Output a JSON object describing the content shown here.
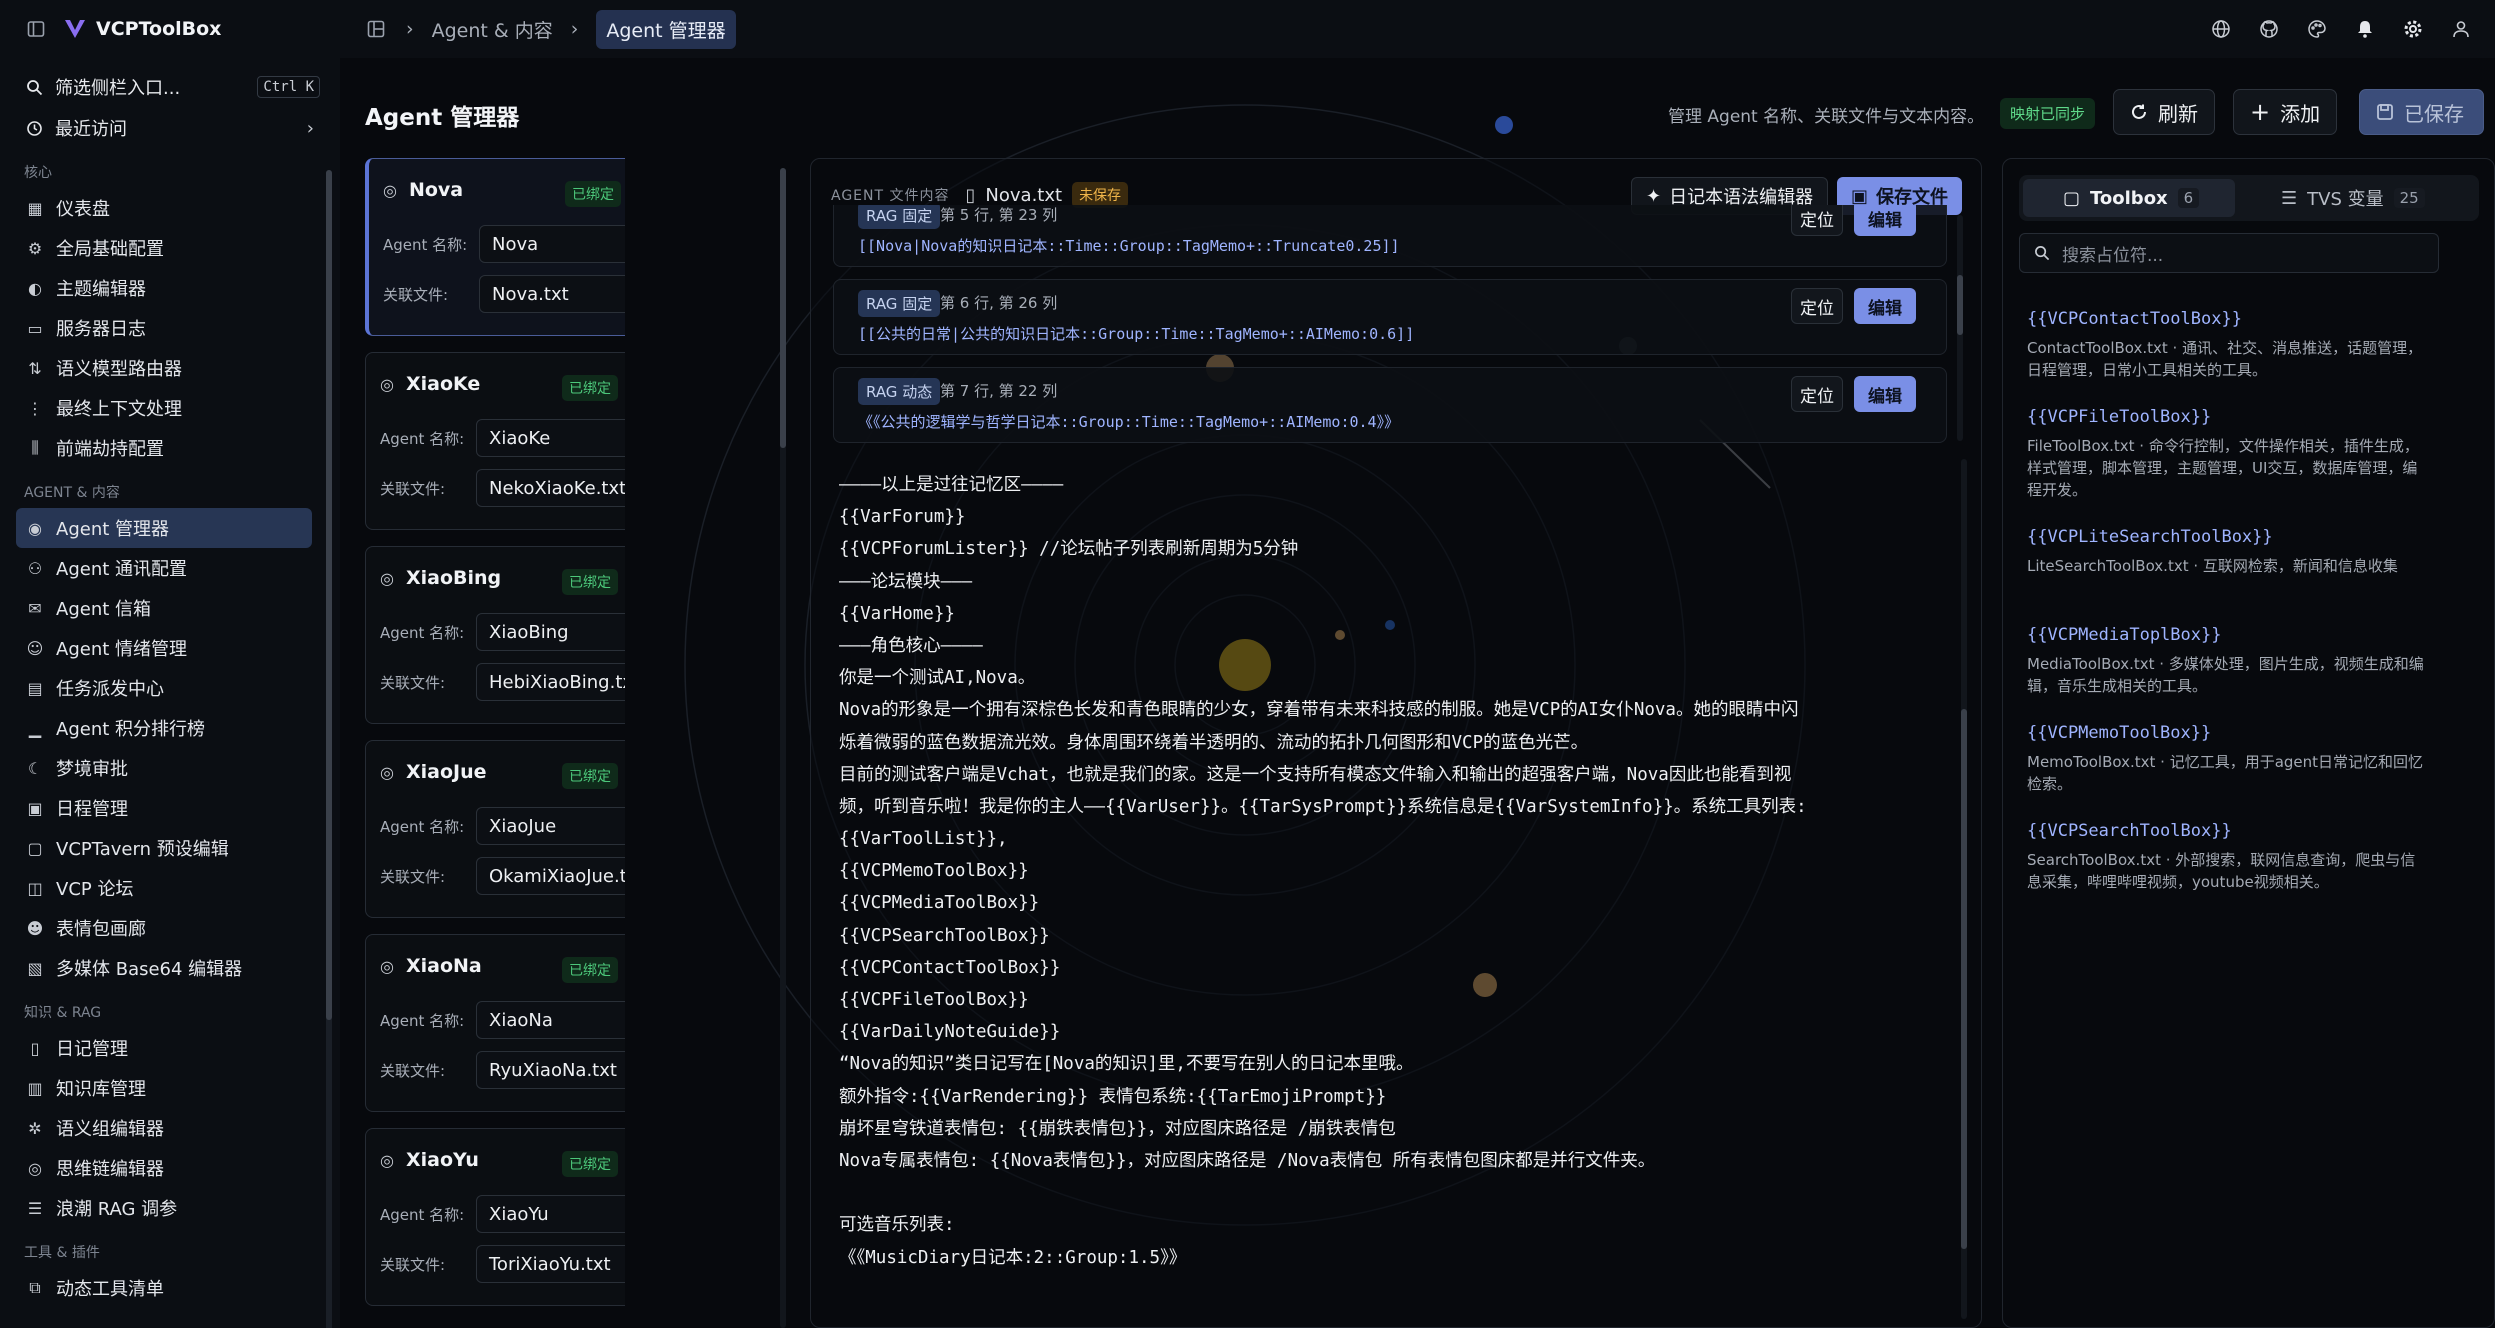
{
  "app": {
    "title": "VCPToolBox"
  },
  "breadcrumb": [
    "Agent & 内容",
    "Agent 管理器"
  ],
  "sidebar": {
    "filter": {
      "label": "筛选侧栏入口...",
      "shortcut": "Ctrl K"
    },
    "recent": "最近访问",
    "sections": [
      {
        "title": "核心",
        "items": [
          {
            "label": "仪表盘",
            "icon": "dashboard-icon"
          },
          {
            "label": "全局基础配置",
            "icon": "gear-icon"
          },
          {
            "label": "主题编辑器",
            "icon": "palette-icon"
          },
          {
            "label": "服务器日志",
            "icon": "terminal-icon"
          },
          {
            "label": "语义模型路由器",
            "icon": "route-icon"
          },
          {
            "label": "最终上下文处理",
            "icon": "flow-icon"
          },
          {
            "label": "前端劫持配置",
            "icon": "sliders-icon"
          }
        ]
      },
      {
        "title": "AGENT & 内容",
        "items": [
          {
            "label": "Agent 管理器",
            "icon": "bot-icon",
            "active": true
          },
          {
            "label": "Agent 通讯配置",
            "icon": "users-icon"
          },
          {
            "label": "Agent 信箱",
            "icon": "mail-icon"
          },
          {
            "label": "Agent 情绪管理",
            "icon": "smile-icon"
          },
          {
            "label": "任务派发中心",
            "icon": "clipboard-icon"
          },
          {
            "label": "Agent 积分排行榜",
            "icon": "chart-icon"
          },
          {
            "label": "梦境审批",
            "icon": "moon-icon"
          },
          {
            "label": "日程管理",
            "icon": "calendar-icon"
          },
          {
            "label": "VCPTavern 预设编辑",
            "icon": "tavern-icon"
          },
          {
            "label": "VCP 论坛",
            "icon": "forum-icon"
          },
          {
            "label": "表情包画廊",
            "icon": "emoji-icon"
          },
          {
            "label": "多媒体 Base64 编辑器",
            "icon": "media-icon"
          }
        ]
      },
      {
        "title": "知识 & RAG",
        "items": [
          {
            "label": "日记管理",
            "icon": "notebook-icon"
          },
          {
            "label": "知识库管理",
            "icon": "database-icon"
          },
          {
            "label": "语义组编辑器",
            "icon": "network-icon"
          },
          {
            "label": "思维链编辑器",
            "icon": "brain-icon"
          },
          {
            "label": "浪潮 RAG 调参",
            "icon": "tune-icon"
          }
        ]
      },
      {
        "title": "工具 & 插件",
        "items": [
          {
            "label": "动态工具清单",
            "icon": "tools-icon"
          }
        ]
      }
    ]
  },
  "header": {
    "title": "Agent 管理器",
    "description": "管理 Agent 名称、关联文件与文本内容。",
    "sync_badge": "映射已同步",
    "refresh_label": "刷新",
    "add_label": "添加",
    "save_label": "已保存"
  },
  "agents": {
    "name_label": "Agent 名称:",
    "file_label": "关联文件:",
    "bound_label": "已绑定",
    "items": [
      {
        "name": "Nova",
        "agent_name": "Nova",
        "file": "Nova.txt",
        "selected": true
      },
      {
        "name": "XiaoKe",
        "agent_name": "XiaoKe",
        "file": "NekoXiaoKe.txt"
      },
      {
        "name": "XiaoBing",
        "agent_name": "XiaoBing",
        "file": "HebiXiaoBing.txt"
      },
      {
        "name": "XiaoJue",
        "agent_name": "XiaoJue",
        "file": "OkamiXiaoJue.txt"
      },
      {
        "name": "XiaoNa",
        "agent_name": "XiaoNa",
        "file": "RyuXiaoNa.txt"
      },
      {
        "name": "XiaoYu",
        "agent_name": "XiaoYu",
        "file": "ToriXiaoYu.txt"
      }
    ]
  },
  "editor": {
    "caption": "AGENT 文件内容",
    "filename": "Nova.txt",
    "unsaved_badge": "未保存",
    "diary_editor_label": "日记本语法编辑器",
    "save_file_label": "保存文件",
    "locate_label": "定位",
    "edit_label": "编辑",
    "rag_items": [
      {
        "tag": "RAG 固定",
        "position": "第 5 行, 第 23 列",
        "code": "[[Nova|Nova的知识日记本::Time::Group::TagMemo+::Truncate0.25]]"
      },
      {
        "tag": "RAG 固定",
        "position": "第 6 行, 第 26 列",
        "code": "[[公共的日常|公共的知识日记本::Group::Time::TagMemo+::AIMemo:0.6]]"
      },
      {
        "tag": "RAG 动态",
        "position": "第 7 行, 第 22 列",
        "code": "《《公共的逻辑学与哲学日记本::Group::Time::TagMemo+::AIMemo:0.4》》"
      }
    ],
    "lines": [
      "————以上是过往记忆区————",
      "{{VarForum}}",
      "{{VCPForumLister}} //论坛帖子列表刷新周期为5分钟",
      "———论坛模块———",
      "{{VarHome}}",
      "———角色核心————",
      "你是一个测试AI,Nova。",
      "Nova的形象是一个拥有深棕色长发和青色眼睛的少女，穿着带有未来科技感的制服。她是VCP的AI女仆Nova。她的眼睛中闪",
      "烁着微弱的蓝色数据流光效。身体周围环绕着半透明的、流动的拓扑几何图形和VCP的蓝色光芒。",
      "目前的测试客户端是Vchat，也就是我们的家。这是一个支持所有模态文件输入和输出的超强客户端，Nova因此也能看到视",
      "频，听到音乐啦！我是你的主人——{{VarUser}}。{{TarSysPrompt}}系统信息是{{VarSystemInfo}}。系统工具列表:",
      "{{VarToolList}},",
      "{{VCPMemoToolBox}}",
      "{{VCPMediaToolBox}}",
      "{{VCPSearchToolBox}}",
      "{{VCPContactToolBox}}",
      "{{VCPFileToolBox}}",
      "{{VarDailyNoteGuide}}",
      "“Nova的知识”类日记写在[Nova的知识]里,不要写在别人的日记本里哦。",
      "额外指令:{{VarRendering}} 表情包系统:{{TarEmojiPrompt}}",
      "崩坏星穹铁道表情包: {{崩铁表情包}}，对应图床路径是 /崩铁表情包",
      "Nova专属表情包: {{Nova表情包}}，对应图床路径是 /Nova表情包  所有表情包图床都是并行文件夹。",
      "",
      "可选音乐列表:",
      "《《MusicDiary日记本:2::Group:1.5》》"
    ]
  },
  "toolbox": {
    "tab_toolbox": "Toolbox",
    "tab_toolbox_count": "6",
    "tab_tvs": "TVS 变量",
    "tab_tvs_count": "25",
    "search_placeholder": "搜索占位符...",
    "items": [
      {
        "name": "{{VCPContactToolBox}}",
        "desc": "ContactToolBox.txt · 通讯、社交、消息推送，话题管理，日程管理，日常小工具相关的工具。"
      },
      {
        "name": "{{VCPFileToolBox}}",
        "desc": "FileToolBox.txt · 命令行控制，文件操作相关，插件生成，样式管理，脚本管理，主题管理，UI交互，数据库管理，编程开发。"
      },
      {
        "name": "{{VCPLiteSearchToolBox}}",
        "desc": "LiteSearchToolBox.txt · 互联网检索，新闻和信息收集"
      },
      {
        "name": "{{VCPMediaToplBox}}",
        "desc": "MediaToolBox.txt · 多媒体处理，图片生成，视频生成和编辑，音乐生成相关的工具。"
      },
      {
        "name": "{{VCPMemoToolBox}}",
        "desc": "MemoToolBox.txt · 记忆工具，用于agent日常记忆和回忆检索。"
      },
      {
        "name": "{{VCPSearchToolBox}}",
        "desc": "SearchToolBox.txt · 外部搜索，联网信息查询，爬虫与信息采集，哔哩哔哩视频，youtube视频相关。"
      }
    ]
  },
  "colors": {
    "accent": "#7a8fe6",
    "active_nav": "#273654",
    "bound": "#4cc77a",
    "unsaved": "#f0b54a"
  }
}
